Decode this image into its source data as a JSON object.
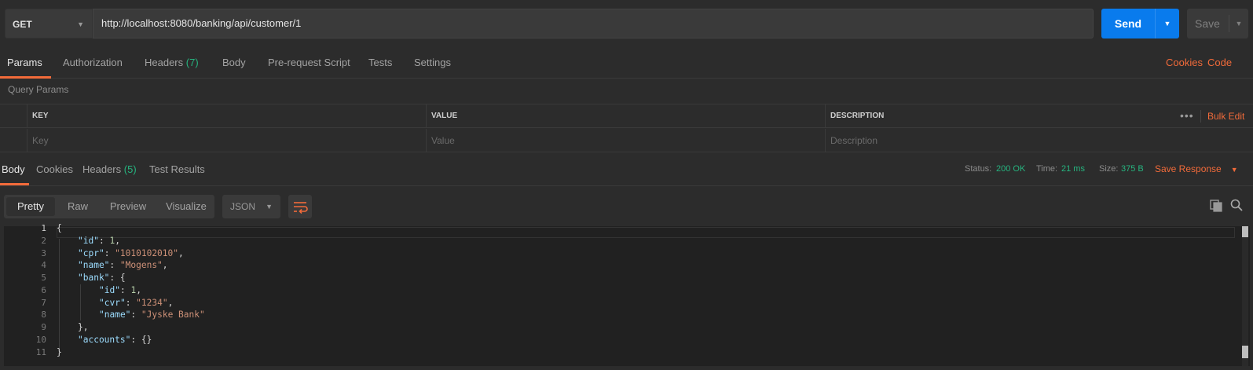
{
  "request": {
    "method": "GET",
    "url": "http://localhost:8080/banking/api/customer/1",
    "send_label": "Send",
    "save_label": "Save"
  },
  "request_tabs": {
    "params": "Params",
    "authorization": "Authorization",
    "headers": "Headers",
    "headers_count": "(7)",
    "body": "Body",
    "prerequest": "Pre-request Script",
    "tests": "Tests",
    "settings": "Settings",
    "cookies": "Cookies",
    "code": "Code"
  },
  "query_params": {
    "title": "Query Params",
    "col_key": "KEY",
    "col_value": "VALUE",
    "col_description": "DESCRIPTION",
    "more": "•••",
    "bulk_edit": "Bulk Edit",
    "key_placeholder": "Key",
    "value_placeholder": "Value",
    "description_placeholder": "Description"
  },
  "response_tabs": {
    "body": "Body",
    "cookies": "Cookies",
    "headers": "Headers",
    "headers_count": "(5)",
    "test_results": "Test Results",
    "status_label": "Status:",
    "status_value": "200 OK",
    "time_label": "Time:",
    "time_value": "21 ms",
    "size_label": "Size:",
    "size_value": "375 B",
    "save_response": "Save Response"
  },
  "view": {
    "pretty": "Pretty",
    "raw": "Raw",
    "preview": "Preview",
    "visualize": "Visualize",
    "format": "JSON"
  },
  "code_lines": [
    {
      "n": "1"
    },
    {
      "n": "2",
      "key": "\"id\"",
      "sep": ": ",
      "num": "1",
      "end": ","
    },
    {
      "n": "3",
      "key": "\"cpr\"",
      "sep": ": ",
      "str": "\"1010102010\"",
      "end": ","
    },
    {
      "n": "4",
      "key": "\"name\"",
      "sep": ": ",
      "str": "\"Mogens\"",
      "end": ","
    },
    {
      "n": "5",
      "key": "\"bank\"",
      "sep": ": ",
      "end": "{"
    },
    {
      "n": "6",
      "key": "\"id\"",
      "sep": ": ",
      "num": "1",
      "end": ","
    },
    {
      "n": "7",
      "key": "\"cvr\"",
      "sep": ": ",
      "str": "\"1234\"",
      "end": ","
    },
    {
      "n": "8",
      "key": "\"name\"",
      "sep": ": ",
      "str": "\"Jyske Bank\""
    },
    {
      "n": "9",
      "end": "},"
    },
    {
      "n": "10",
      "key": "\"accounts\"",
      "sep": ": ",
      "end": "{}"
    },
    {
      "n": "11"
    }
  ],
  "code_text": {
    "open": "{",
    "close": "}"
  }
}
